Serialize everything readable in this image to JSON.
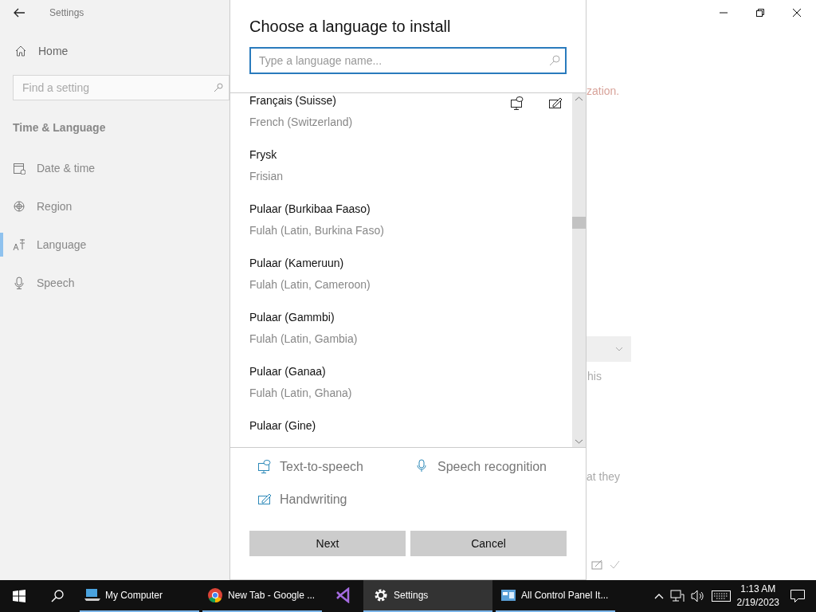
{
  "settings_window": {
    "title": "Settings",
    "home": "Home",
    "search": {
      "placeholder": "Find a setting"
    },
    "section": "Time & Language",
    "nav_items": [
      {
        "kind": "date",
        "label": "Date & time",
        "selected": false
      },
      {
        "kind": "region",
        "label": "Region",
        "selected": false
      },
      {
        "kind": "language",
        "label": "Language",
        "selected": true
      },
      {
        "kind": "speech",
        "label": "Speech",
        "selected": false
      }
    ],
    "background_fragments": [
      "zation.",
      "his",
      "at they"
    ]
  },
  "dialog": {
    "title": "Choose a language to install",
    "search": {
      "placeholder": "Type a language name..."
    },
    "languages": [
      {
        "name": "Français (Suisse)",
        "english": "French (Switzerland)",
        "text_to_speech": true,
        "handwriting": true
      },
      {
        "name": "Frysk",
        "english": "Frisian",
        "text_to_speech": false,
        "handwriting": false
      },
      {
        "name": "Pulaar (Burkibaa Faaso)",
        "english": "Fulah (Latin, Burkina Faso)",
        "text_to_speech": false,
        "handwriting": false
      },
      {
        "name": "Pulaar (Kameruun)",
        "english": "Fulah (Latin, Cameroon)",
        "text_to_speech": false,
        "handwriting": false
      },
      {
        "name": "Pulaar (Gammbi)",
        "english": "Fulah (Latin, Gambia)",
        "text_to_speech": false,
        "handwriting": false
      },
      {
        "name": "Pulaar (Ganaa)",
        "english": "Fulah (Latin, Ghana)",
        "text_to_speech": false,
        "handwriting": false
      },
      {
        "name": "Pulaar (Gine)",
        "text_to_speech": false,
        "handwriting": false
      }
    ],
    "legend": [
      {
        "kind": "tts",
        "label": "Text-to-speech"
      },
      {
        "kind": "speech",
        "label": "Speech recognition"
      },
      {
        "kind": "handwriting",
        "label": "Handwriting"
      }
    ],
    "buttons": [
      "Next",
      "Cancel"
    ]
  },
  "taskbar": {
    "items": [
      {
        "kind": "computer",
        "label": "My Computer",
        "selected": false
      },
      {
        "kind": "chrome",
        "label": "New Tab - Google ...",
        "selected": false
      },
      {
        "kind": "vs",
        "selected": false
      },
      {
        "kind": "gear",
        "label": "Settings",
        "selected": true
      },
      {
        "kind": "panel",
        "label": "All Control Panel It...",
        "selected": false
      }
    ],
    "time": "1:13 AM",
    "date": "2/19/2023"
  }
}
